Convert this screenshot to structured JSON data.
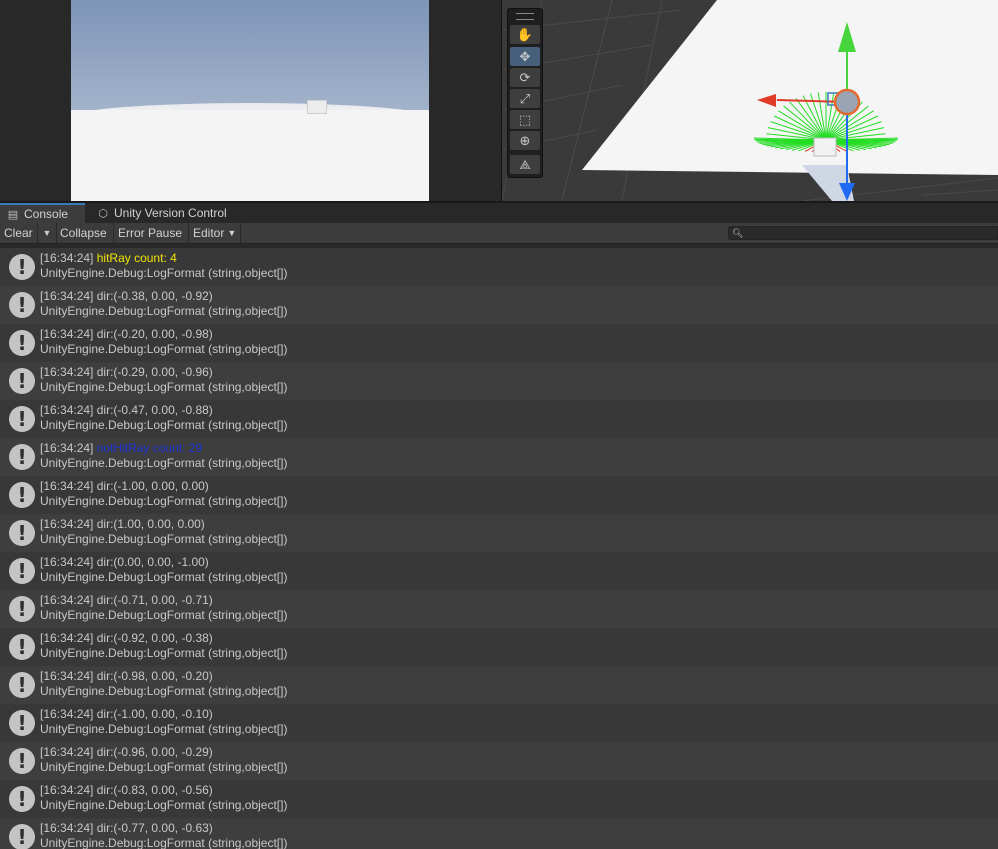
{
  "tabs": {
    "console": "Console",
    "uvc": "Unity Version Control"
  },
  "console_toolbar": {
    "clear": "Clear",
    "collapse": "Collapse",
    "error_pause": "Error Pause",
    "editor": "Editor",
    "search_placeholder": ""
  },
  "colors": {
    "hit_message": "#f0e400",
    "nothit_message": "#1d34d6",
    "gizmo_y": "#46d63c",
    "gizmo_x": "#e03a28",
    "gizmo_z": "#1f6cf2",
    "ray_lines": "#22dd22"
  },
  "scene_tools": [
    "hand-icon",
    "move-icon",
    "rotate-icon",
    "scale-icon",
    "rect-icon",
    "transform-icon",
    "custom-tool-icon"
  ],
  "logs": [
    {
      "time": "[16:34:24]",
      "msg": "hitRay count: 4",
      "style": "yellow",
      "trace": "UnityEngine.Debug:LogFormat (string,object[])"
    },
    {
      "time": "[16:34:24]",
      "msg": "dir:(-0.38, 0.00, -0.92)",
      "style": "",
      "trace": "UnityEngine.Debug:LogFormat (string,object[])"
    },
    {
      "time": "[16:34:24]",
      "msg": "dir:(-0.20, 0.00, -0.98)",
      "style": "",
      "trace": "UnityEngine.Debug:LogFormat (string,object[])"
    },
    {
      "time": "[16:34:24]",
      "msg": "dir:(-0.29, 0.00, -0.96)",
      "style": "",
      "trace": "UnityEngine.Debug:LogFormat (string,object[])"
    },
    {
      "time": "[16:34:24]",
      "msg": "dir:(-0.47, 0.00, -0.88)",
      "style": "",
      "trace": "UnityEngine.Debug:LogFormat (string,object[])"
    },
    {
      "time": "[16:34:24]",
      "msg": "notHitRay count: 29",
      "style": "blue",
      "trace": "UnityEngine.Debug:LogFormat (string,object[])"
    },
    {
      "time": "[16:34:24]",
      "msg": "dir:(-1.00, 0.00, 0.00)",
      "style": "",
      "trace": "UnityEngine.Debug:LogFormat (string,object[])"
    },
    {
      "time": "[16:34:24]",
      "msg": "dir:(1.00, 0.00, 0.00)",
      "style": "",
      "trace": "UnityEngine.Debug:LogFormat (string,object[])"
    },
    {
      "time": "[16:34:24]",
      "msg": "dir:(0.00, 0.00, -1.00)",
      "style": "",
      "trace": "UnityEngine.Debug:LogFormat (string,object[])"
    },
    {
      "time": "[16:34:24]",
      "msg": "dir:(-0.71, 0.00, -0.71)",
      "style": "",
      "trace": "UnityEngine.Debug:LogFormat (string,object[])"
    },
    {
      "time": "[16:34:24]",
      "msg": "dir:(-0.92, 0.00, -0.38)",
      "style": "",
      "trace": "UnityEngine.Debug:LogFormat (string,object[])"
    },
    {
      "time": "[16:34:24]",
      "msg": "dir:(-0.98, 0.00, -0.20)",
      "style": "",
      "trace": "UnityEngine.Debug:LogFormat (string,object[])"
    },
    {
      "time": "[16:34:24]",
      "msg": "dir:(-1.00, 0.00, -0.10)",
      "style": "",
      "trace": "UnityEngine.Debug:LogFormat (string,object[])"
    },
    {
      "time": "[16:34:24]",
      "msg": "dir:(-0.96, 0.00, -0.29)",
      "style": "",
      "trace": "UnityEngine.Debug:LogFormat (string,object[])"
    },
    {
      "time": "[16:34:24]",
      "msg": "dir:(-0.83, 0.00, -0.56)",
      "style": "",
      "trace": "UnityEngine.Debug:LogFormat (string,object[])"
    },
    {
      "time": "[16:34:24]",
      "msg": "dir:(-0.77, 0.00, -0.63)",
      "style": "",
      "trace": "UnityEngine.Debug:LogFormat (string,object[])"
    }
  ]
}
